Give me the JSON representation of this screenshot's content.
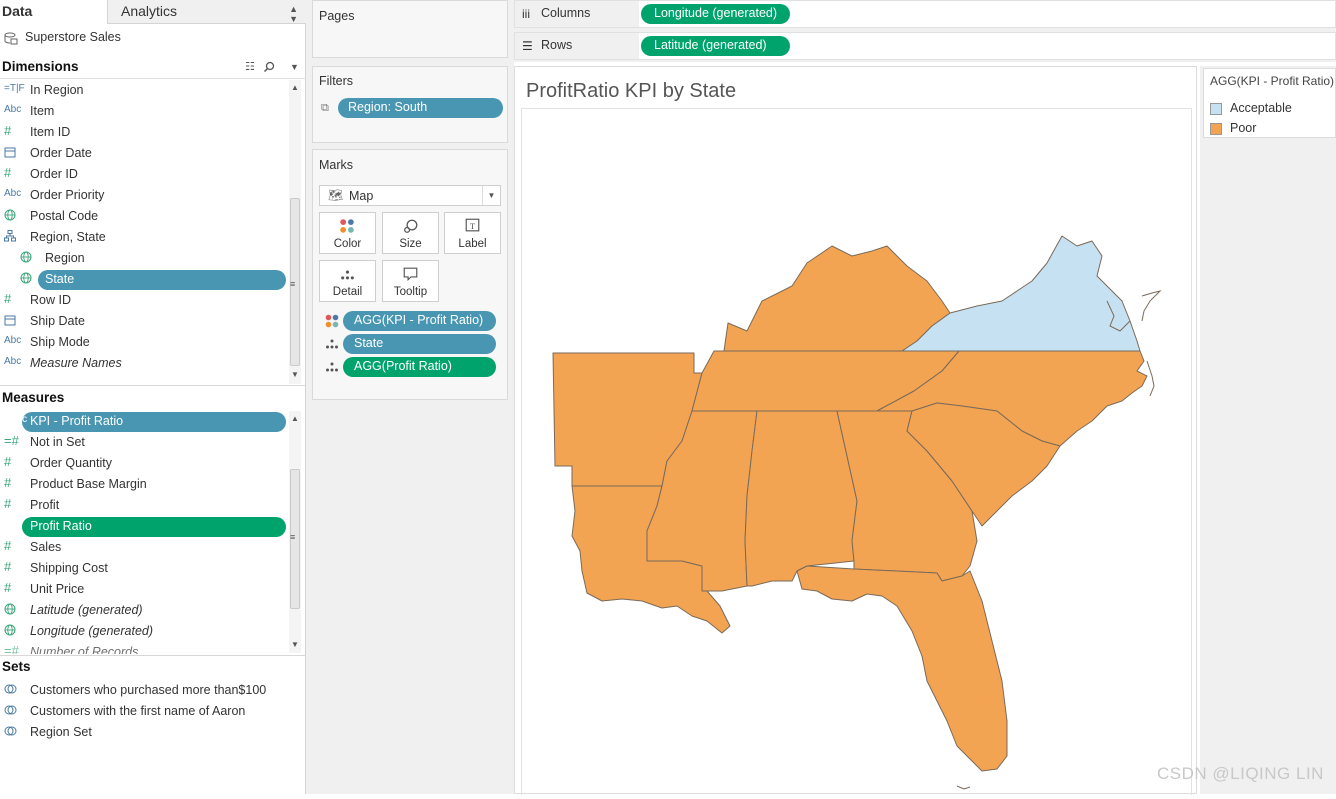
{
  "tabs": {
    "data": "Data",
    "analytics": "Analytics"
  },
  "datasource": "Superstore Sales",
  "dimensions": {
    "header": "Dimensions",
    "items": [
      {
        "type": "=T|F",
        "label": "In Region",
        "italic": false
      },
      {
        "type": "Abc",
        "label": "Item",
        "italic": false
      },
      {
        "type": "#",
        "label": "Item ID",
        "italic": false
      },
      {
        "type": "date",
        "label": "Order Date",
        "italic": false
      },
      {
        "type": "#",
        "label": "Order ID",
        "italic": false
      },
      {
        "type": "Abc",
        "label": "Order Priority",
        "italic": false
      },
      {
        "type": "geo",
        "label": "Postal Code",
        "italic": false
      },
      {
        "type": "hier",
        "label": "Region, State",
        "italic": false
      },
      {
        "type": "geo",
        "label": "Region",
        "italic": false
      },
      {
        "type": "geo",
        "label": "State",
        "italic": false
      },
      {
        "type": "#",
        "label": "Row ID",
        "italic": false
      },
      {
        "type": "date",
        "label": "Ship Date",
        "italic": false
      },
      {
        "type": "Abc",
        "label": "Ship Mode",
        "italic": false
      },
      {
        "type": "Abc",
        "label": "Measure Names",
        "italic": true
      }
    ]
  },
  "measures": {
    "header": "Measures",
    "items": [
      {
        "type": "=Abc",
        "label": "KPI - Profit Ratio",
        "italic": false
      },
      {
        "type": "=#",
        "label": "Not in Set",
        "italic": false
      },
      {
        "type": "#",
        "label": "Order Quantity",
        "italic": false
      },
      {
        "type": "#",
        "label": "Product Base Margin",
        "italic": false
      },
      {
        "type": "#",
        "label": "Profit",
        "italic": false
      },
      {
        "type": "=#",
        "label": "Profit Ratio",
        "italic": false
      },
      {
        "type": "#",
        "label": "Sales",
        "italic": false
      },
      {
        "type": "#",
        "label": "Shipping Cost",
        "italic": false
      },
      {
        "type": "#",
        "label": "Unit Price",
        "italic": false
      },
      {
        "type": "geo",
        "label": "Latitude (generated)",
        "italic": true
      },
      {
        "type": "geo",
        "label": "Longitude (generated)",
        "italic": true
      },
      {
        "type": "=#",
        "label": "Number of Records",
        "italic": true
      }
    ]
  },
  "sets": {
    "header": "Sets",
    "items": [
      "Customers who purchased more than$100",
      "Customers with the first name of Aaron",
      "Region Set"
    ]
  },
  "pages": {
    "title": "Pages"
  },
  "filters": {
    "title": "Filters",
    "items": [
      "Region: South"
    ]
  },
  "marks": {
    "title": "Marks",
    "type": "Map",
    "buttons": [
      "Color",
      "Size",
      "Label",
      "Detail",
      "Tooltip"
    ],
    "pills": [
      "AGG(KPI - Profit Ratio)",
      "State",
      "AGG(Profit Ratio)"
    ]
  },
  "shelves": {
    "columns_label": "Columns",
    "columns_pill": "Longitude (generated)",
    "rows_label": "Rows",
    "rows_pill": "Latitude (generated)"
  },
  "sheet": {
    "title": "ProfitRatio KPI by State"
  },
  "legend": {
    "title": "AGG(KPI - Profit Ratio)",
    "items": [
      {
        "label": "Acceptable",
        "color": "#c6e1f2"
      },
      {
        "label": "Poor",
        "color": "#f3a452"
      }
    ]
  },
  "colors": {
    "blue_pill": "#4996b2",
    "green_pill": "#00a36b",
    "poor": "#f3a452",
    "acceptable": "#c6e1f2"
  },
  "watermark": "CSDN @LIQING LIN"
}
